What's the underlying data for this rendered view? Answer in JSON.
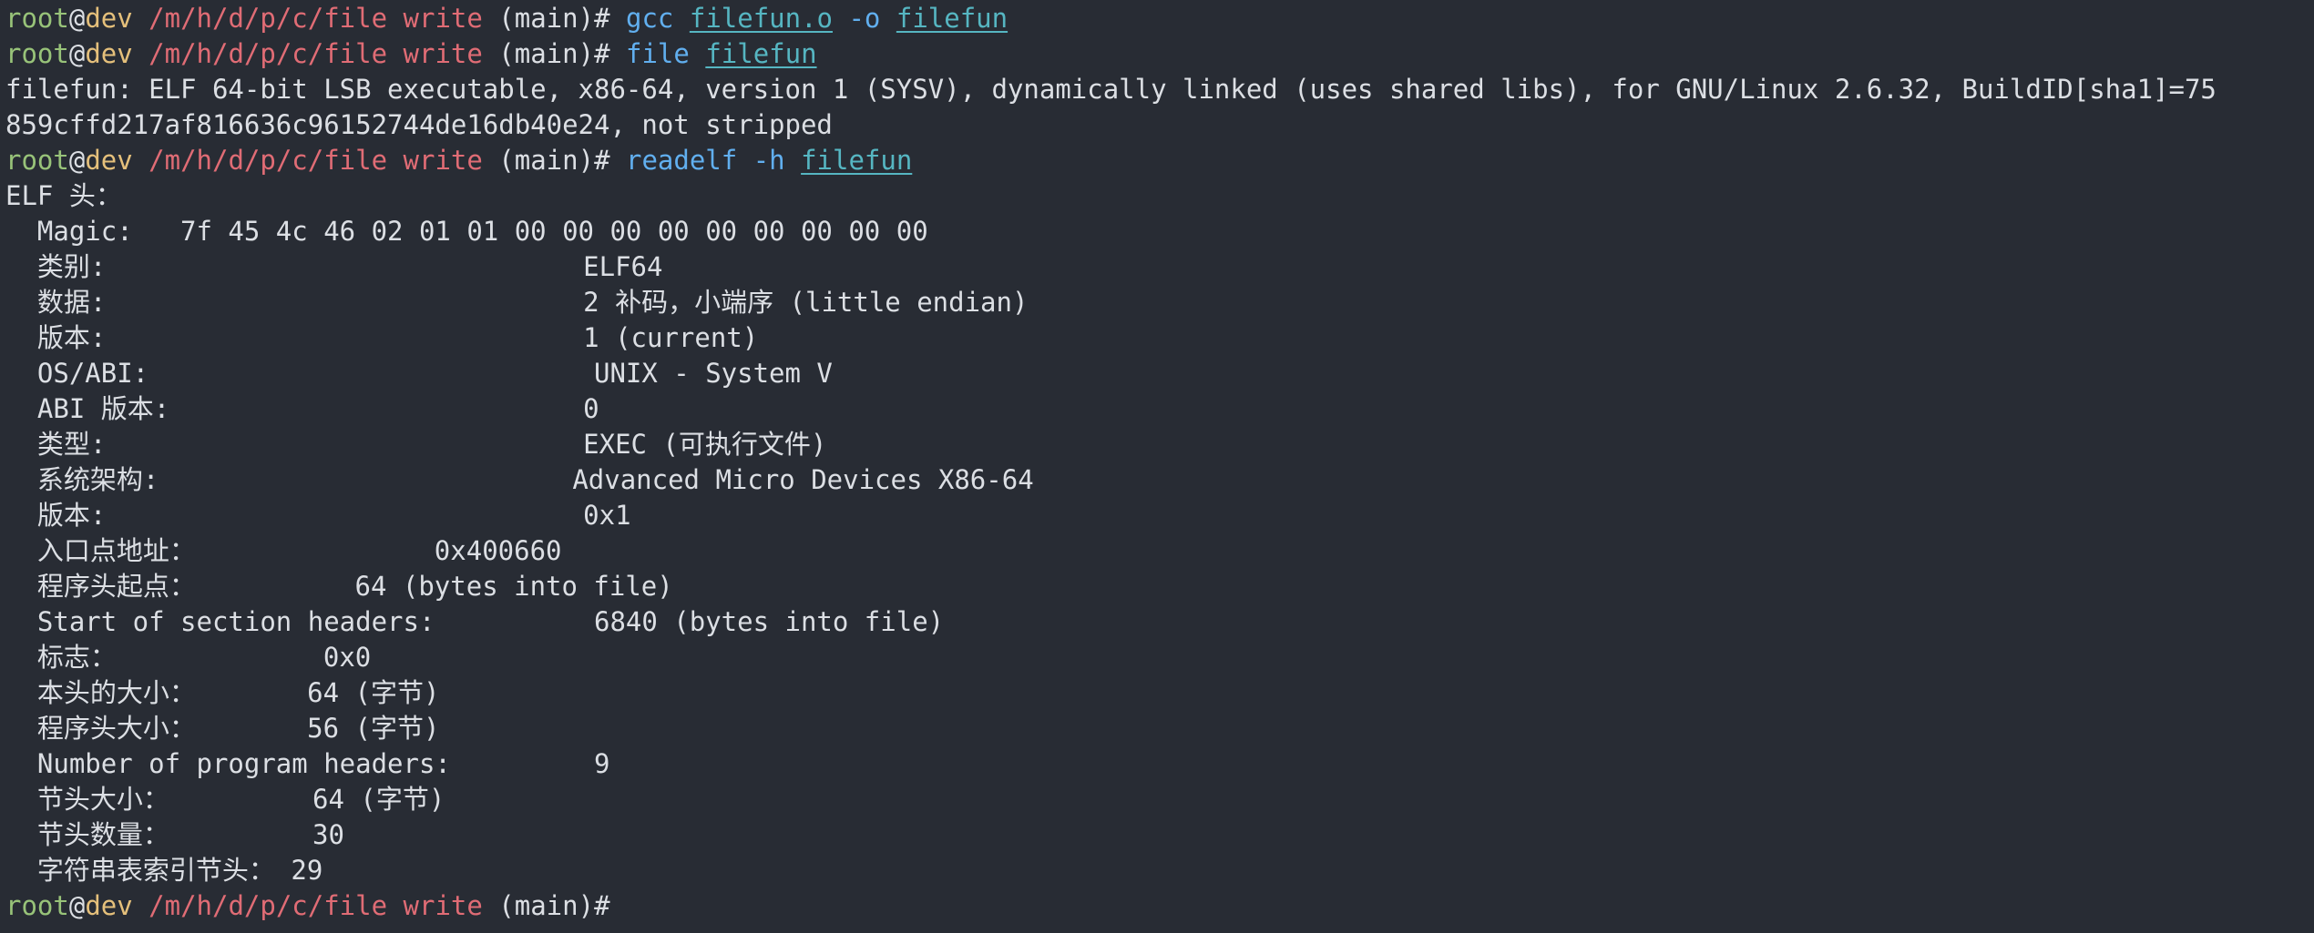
{
  "prompt": {
    "user": "root",
    "at": "@",
    "host": "dev",
    "path": "/m/h/d/p/c/file write",
    "branch": "(main)",
    "symbol": "#"
  },
  "commands": [
    {
      "cmd": "gcc",
      "arg1": "filefun.o",
      "flag": "-o",
      "arg2": "filefun"
    },
    {
      "cmd": "file",
      "arg1": "filefun"
    },
    {
      "cmd": "readelf",
      "flag": "-h",
      "arg1": "filefun"
    }
  ],
  "file_output": [
    "filefun: ELF 64-bit LSB executable, x86-64, version 1 (SYSV), dynamically linked (uses shared libs), for GNU/Linux 2.6.32, BuildID[sha1]=75",
    "859cffd217af816636c96152744de16db40e24, not stripped"
  ],
  "elf_header": [
    "ELF 头：",
    "  Magic:   7f 45 4c 46 02 01 01 00 00 00 00 00 00 00 00 00",
    "  类别:                              ELF64",
    "  数据:                              2 补码，小端序 (little endian)",
    "  版本:                              1 (current)",
    "  OS/ABI:                            UNIX - System V",
    "  ABI 版本:                          0",
    "  类型:                              EXEC (可执行文件)",
    "  系统架构:                          Advanced Micro Devices X86-64",
    "  版本:                              0x1",
    "  入口点地址：               0x400660",
    "  程序头起点：          64 (bytes into file)",
    "  Start of section headers:          6840 (bytes into file)",
    "  标志：             0x0",
    "  本头的大小：       64 (字节)",
    "  程序头大小：       56 (字节)",
    "  Number of program headers:         9",
    "  节头大小：         64 (字节)",
    "  节头数量：         30",
    "  字符串表索引节头： 29"
  ],
  "colors": {
    "background": "#282c34",
    "user": "#98c379",
    "host": "#e5c07b",
    "path": "#e06c75",
    "command": "#61afef",
    "argument": "#56b6c2",
    "text": "#dcdfe4"
  }
}
